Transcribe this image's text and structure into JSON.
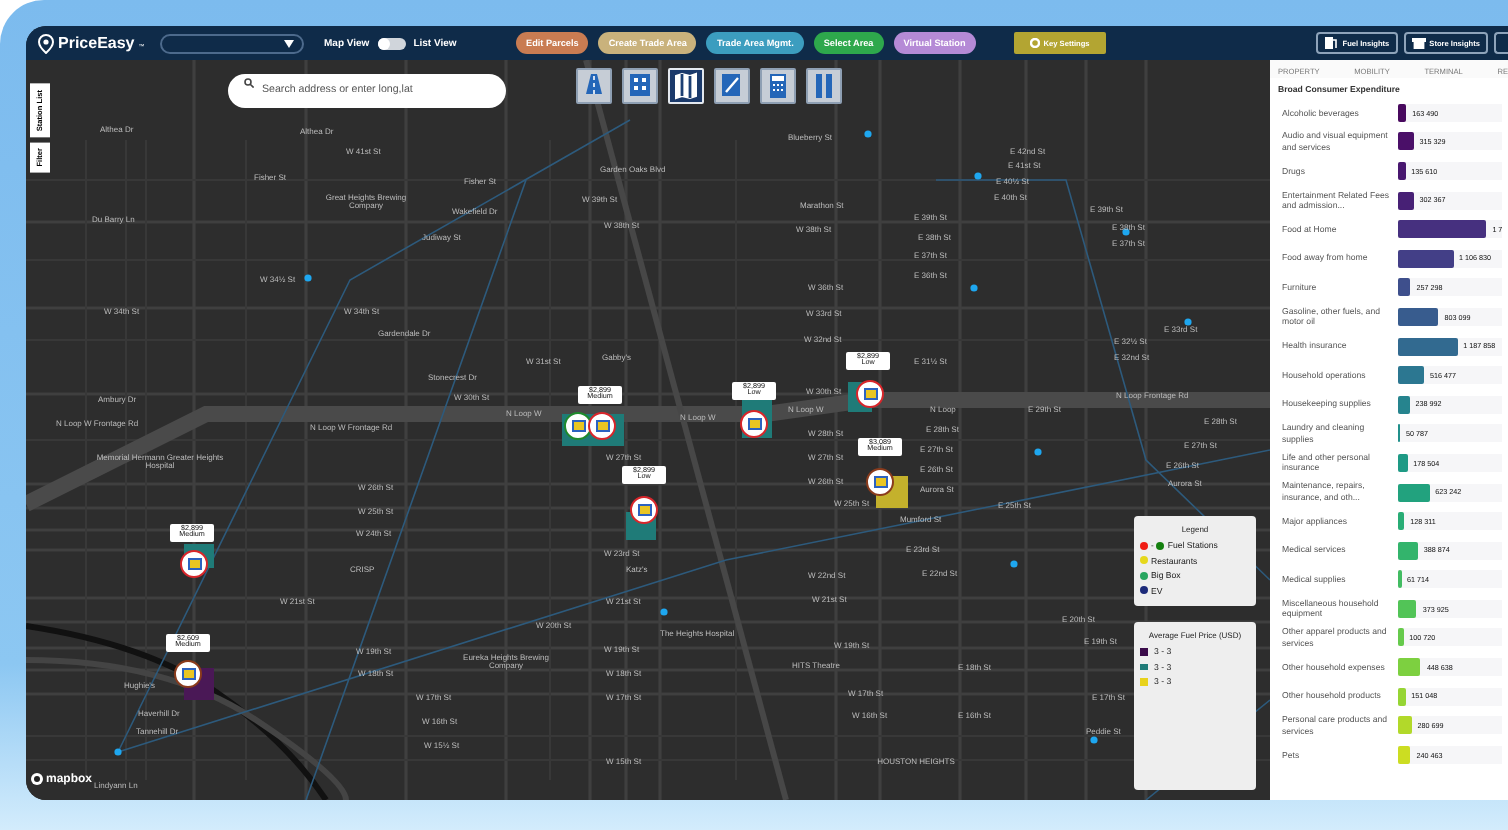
{
  "header": {
    "logo": "PriceEasy",
    "logo_mark": "™",
    "view_toggle": {
      "left_label": "Map View",
      "right_label": "List View",
      "on": false
    },
    "actions": [
      {
        "label": "Edit Parcels",
        "color": "#c97c52"
      },
      {
        "label": "Create Trade Area",
        "color": "#c9b27c"
      },
      {
        "label": "Trade Area Mgmt.",
        "color": "#3c9dbf"
      },
      {
        "label": "Select Area",
        "color": "#2ea84c"
      },
      {
        "label": "Virtual Station",
        "color": "#b58ad6"
      }
    ],
    "key_settings": "Key Settings",
    "insights": [
      {
        "label": "Fuel Insights",
        "kind": "pump"
      },
      {
        "label": "Store Insights",
        "kind": "store"
      }
    ]
  },
  "search": {
    "placeholder": "Search address or enter long,lat"
  },
  "map_tools": [
    {
      "kind": "road",
      "selected": false
    },
    {
      "kind": "grid",
      "selected": false
    },
    {
      "kind": "map",
      "selected": true
    },
    {
      "kind": "edit",
      "selected": false
    },
    {
      "kind": "calculator",
      "selected": false
    },
    {
      "kind": "columns",
      "selected": false
    }
  ],
  "side_tabs": [
    "Station List",
    "Filter"
  ],
  "street_labels": [
    "Althea Dr",
    "Althea Dr",
    "W 41st St",
    "Fisher St",
    "Fisher St",
    "Garden Oaks Blvd",
    "Great Heights Brewing Company",
    "Wakefield Dr",
    "W 39th St",
    "W 38th St",
    "Du Barry Ln",
    "Judiway St",
    "W 34½ St",
    "W 34th St",
    "W 34th St",
    "Gardendale Dr",
    "W 31st St",
    "Gabby's",
    "Stonecrest Dr",
    "Ambury Dr",
    "W 30th St",
    "N Loop W Frontage Rd",
    "N Loop W",
    "N Loop W",
    "N Loop W Frontage Rd",
    "Memorial Hermann Greater Heights Hospital",
    "W 27th St",
    "W 26th St",
    "W 25th St",
    "W 24th St",
    "W 23rd St",
    "CRISP",
    "Katz's",
    "W 21st St",
    "W 21st St",
    "W 20th St",
    "W 19th St",
    "W 19th St",
    "Eureka Heights Brewing Company",
    "W 18th St",
    "W 18th St",
    "W 17th St",
    "W 17th St",
    "Hughie's",
    "Haverhill Dr",
    "Tannehill Dr",
    "W 16th St",
    "W 15½ St",
    "W 15th St",
    "The Heights Hospital",
    "Lindyann Ln",
    "Blueberry St",
    "E 42nd St",
    "E 41st St",
    "E 40½ St",
    "E 40th St",
    "Marathon St",
    "W 38th St",
    "E 39th St",
    "E 38th St",
    "E 37th St",
    "E 36th St",
    "W 36th St",
    "W 33rd St",
    "W 32nd St",
    "E 31½ St",
    "W 30th St",
    "N Loop W",
    "N Loop",
    "E 29th St",
    "N Loop Frontage Rd",
    "E 28th St",
    "W 28th St",
    "E 28th St",
    "W 27th St",
    "E 27th St",
    "E 27th St",
    "W 26th St",
    "E 26th St",
    "E 26th St",
    "Aurora St",
    "Aurora St",
    "W 25th St",
    "E 25th St",
    "Mumford St",
    "E 23rd St",
    "W 22nd St",
    "E 22nd St",
    "W 21st St",
    "E 20th St",
    "W 19th St",
    "E 19th St",
    "HITS Theatre",
    "E 18th St",
    "W 17th St",
    "E 17th St",
    "W 16th St",
    "E 16th St",
    "Peddie St",
    "HOUSTON HEIGHTS",
    "E 33rd St",
    "E 32½ St",
    "E 32nd St",
    "E 39th St",
    "E 38th St",
    "E 37th St"
  ],
  "stations": [
    {
      "price": "$2,899",
      "price_level": "Medium",
      "parcel": {
        "color": "#1f7b78"
      },
      "markers": [
        {
          "color": "#1f8a2c"
        },
        {
          "color": "#d8262b"
        }
      ]
    },
    {
      "price": "$2,899",
      "price_level": "Low",
      "parcel": {
        "color": "#1f7b78"
      },
      "markers": [
        {
          "color": "#d8262b"
        }
      ]
    },
    {
      "price": "$2,899",
      "price_level": "Low",
      "parcel": {
        "color": "#1f7b78"
      },
      "markers": [
        {
          "color": "#d8262b"
        }
      ]
    },
    {
      "price": "$2,899",
      "price_level": "Low",
      "parcel": {
        "color": "#1f7b78"
      },
      "markers": [
        {
          "color": "#d8262b"
        }
      ]
    },
    {
      "price": "$3,089",
      "price_level": "Medium",
      "parcel": {
        "color": "#c4b12c"
      },
      "markers": [
        {
          "color": "#8a3b1c"
        }
      ]
    },
    {
      "price": "$2,899",
      "price_level": "Medium",
      "parcel": {
        "color": "#1f7b78"
      },
      "markers": [
        {
          "color": "#d8262b"
        }
      ]
    },
    {
      "price": "$2,609",
      "price_level": "Medium",
      "parcel": {
        "color": "#4a1856"
      },
      "markers": [
        {
          "color": "#8a3b1c"
        }
      ]
    }
  ],
  "legend": {
    "title": "Legend",
    "items": [
      {
        "label": "Fuel Stations",
        "dash": "-",
        "dots": [
          {
            "color": "#f01c14"
          },
          {
            "color": "#14800f"
          }
        ]
      },
      {
        "label": "Restaurants",
        "dots": [
          {
            "color": "#e6d81c"
          }
        ]
      },
      {
        "label": "Big Box",
        "dots": [
          {
            "color": "#28a660"
          }
        ]
      },
      {
        "label": "EV",
        "dots": [
          {
            "color": "#1c2a7a"
          }
        ]
      }
    ]
  },
  "price_legend": {
    "title": "Average Fuel Price (USD)",
    "items": [
      {
        "label": "3 - 3",
        "color": "#3a0b4a"
      },
      {
        "label": "3 - 3",
        "color": "#1f7b78"
      },
      {
        "label": "3 - 3",
        "color": "#e8d21c"
      }
    ]
  },
  "attribution": "mapbox",
  "panel": {
    "tabs": [
      "PROPERTY",
      "MOBILITY",
      "TERMINAL",
      "RE"
    ],
    "title": "Broad Consumer Expenditure",
    "rows": [
      {
        "label": "Alcoholic beverages",
        "value": "163 490",
        "level": 0.08,
        "color": "#48095e"
      },
      {
        "label": "Audio and visual equipment and services",
        "value": "315 329",
        "level": 0.15,
        "color": "#4a0f68"
      },
      {
        "label": "Drugs",
        "value": "135 610",
        "level": 0.07,
        "color": "#48176f"
      },
      {
        "label": "Entertainment Related Fees and admission...",
        "value": "302 367",
        "level": 0.15,
        "color": "#472075"
      },
      {
        "label": "Food at Home",
        "value": "1 7",
        "level": 0.85,
        "color": "#46307f"
      },
      {
        "label": "Food away from home",
        "value": "1 106 830",
        "level": 0.53,
        "color": "#433f87"
      },
      {
        "label": "Furniture",
        "value": "257 298",
        "level": 0.12,
        "color": "#3e4f8c"
      },
      {
        "label": "Gasoline, other fuels, and motor oil",
        "value": "803 099",
        "level": 0.39,
        "color": "#385c8e"
      },
      {
        "label": "Health insurance",
        "value": "1 187 858",
        "level": 0.57,
        "color": "#326a90"
      },
      {
        "label": "Household operations",
        "value": "516 477",
        "level": 0.25,
        "color": "#2c7791"
      },
      {
        "label": "Housekeeping supplies",
        "value": "238 992",
        "level": 0.11,
        "color": "#26848e"
      },
      {
        "label": "Laundry and cleaning supplies",
        "value": "50 787",
        "level": 0.02,
        "color": "#21908b"
      },
      {
        "label": "Life and other personal insurance",
        "value": "178 504",
        "level": 0.09,
        "color": "#1e9a85"
      },
      {
        "label": "Maintenance, repairs, insurance, and oth...",
        "value": "623 242",
        "level": 0.3,
        "color": "#22a27e"
      },
      {
        "label": "Major appliances",
        "value": "128 311",
        "level": 0.06,
        "color": "#28ac75"
      },
      {
        "label": "Medical services",
        "value": "388 874",
        "level": 0.19,
        "color": "#33b46c"
      },
      {
        "label": "Medical supplies",
        "value": "61 714",
        "level": 0.03,
        "color": "#42bc62"
      },
      {
        "label": "Miscellaneous household equipment",
        "value": "373 925",
        "level": 0.18,
        "color": "#52c457"
      },
      {
        "label": "Other apparel products and services",
        "value": "100 720",
        "level": 0.05,
        "color": "#66ca4c"
      },
      {
        "label": "Other household expenses",
        "value": "448 638",
        "level": 0.22,
        "color": "#7dd040"
      },
      {
        "label": "Other household products",
        "value": "151 048",
        "level": 0.07,
        "color": "#96d534"
      },
      {
        "label": "Personal care products and services",
        "value": "280 699",
        "level": 0.13,
        "color": "#b2d92a"
      },
      {
        "label": "Pets",
        "value": "240 463",
        "level": 0.12,
        "color": "#ccdd22"
      }
    ]
  }
}
